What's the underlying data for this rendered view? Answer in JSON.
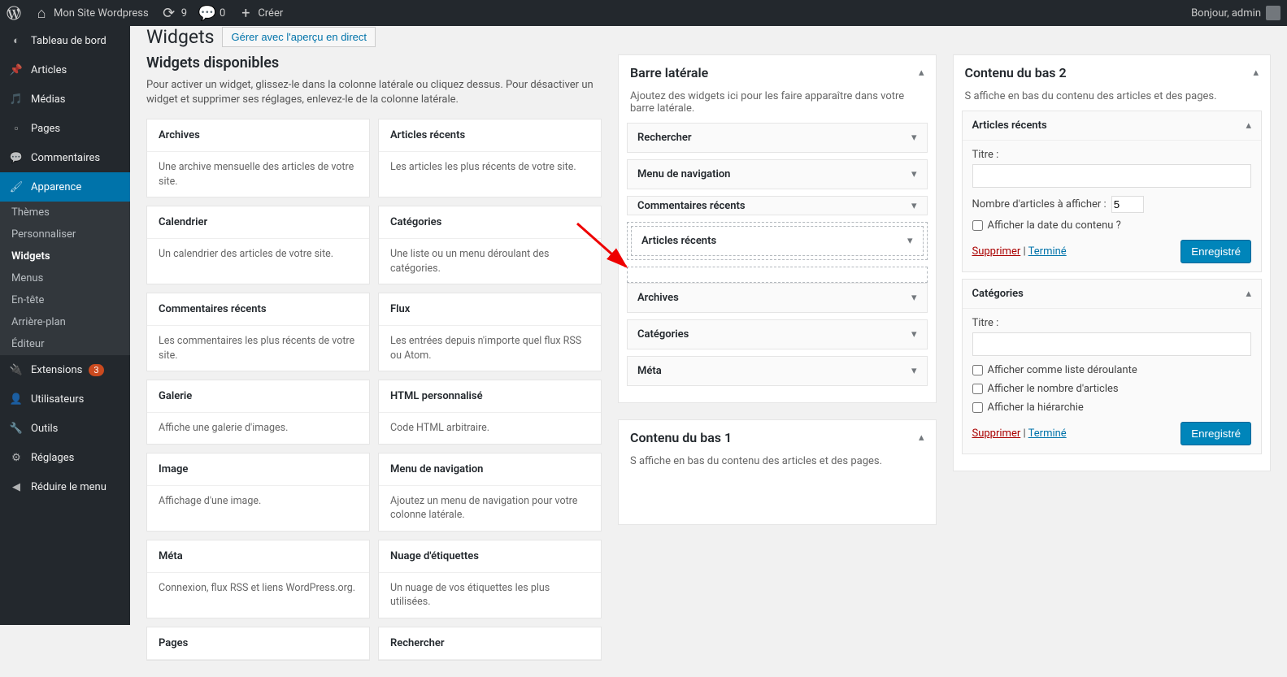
{
  "toolbar": {
    "site_name": "Mon Site Wordpress",
    "updates_count": "9",
    "comments_count": "0",
    "create_label": "Créer",
    "greeting": "Bonjour, admin"
  },
  "menu": {
    "dashboard": "Tableau de bord",
    "posts": "Articles",
    "media": "Médias",
    "pages": "Pages",
    "comments": "Commentaires",
    "appearance": "Apparence",
    "appearance_sub": {
      "themes": "Thèmes",
      "customize": "Personnaliser",
      "widgets": "Widgets",
      "menus": "Menus",
      "header": "En-tête",
      "background": "Arrière-plan",
      "editor": "Éditeur"
    },
    "plugins": "Extensions",
    "plugins_badge": "3",
    "users": "Utilisateurs",
    "tools": "Outils",
    "settings": "Réglages",
    "collapse": "Réduire le menu"
  },
  "page": {
    "title": "Widgets",
    "manage_live": "Gérer avec l'aperçu en direct"
  },
  "available": {
    "title": "Widgets disponibles",
    "desc": "Pour activer un widget, glissez-le dans la colonne latérale ou cliquez dessus. Pour désactiver un widget et supprimer ses réglages, enlevez-le de la colonne latérale.",
    "widgets": [
      {
        "name": "Archives",
        "desc": "Une archive mensuelle des articles de votre site."
      },
      {
        "name": "Articles récents",
        "desc": "Les articles les plus récents de votre site."
      },
      {
        "name": "Calendrier",
        "desc": "Un calendrier des articles de votre site."
      },
      {
        "name": "Catégories",
        "desc": "Une liste ou un menu déroulant des catégories."
      },
      {
        "name": "Commentaires récents",
        "desc": "Les commentaires les plus récents de votre site."
      },
      {
        "name": "Flux",
        "desc": "Les entrées depuis n'importe quel flux RSS ou Atom."
      },
      {
        "name": "Galerie",
        "desc": "Affiche une galerie d'images."
      },
      {
        "name": "HTML personnalisé",
        "desc": "Code HTML arbitraire."
      },
      {
        "name": "Image",
        "desc": "Affichage d'une image."
      },
      {
        "name": "Menu de navigation",
        "desc": "Ajoutez un menu de navigation pour votre colonne latérale."
      },
      {
        "name": "Méta",
        "desc": "Connexion, flux RSS et liens WordPress.org."
      },
      {
        "name": "Nuage d'étiquettes",
        "desc": "Un nuage de vos étiquettes les plus utilisées."
      },
      {
        "name": "Pages",
        "desc": ""
      },
      {
        "name": "Rechercher",
        "desc": ""
      }
    ]
  },
  "sidebar_area": {
    "title": "Barre latérale",
    "desc": "Ajoutez des widgets ici pour les faire apparaître dans votre barre latérale.",
    "widgets": [
      "Rechercher",
      "Menu de navigation",
      "Commentaires récents",
      "Archives",
      "Catégories",
      "Méta"
    ],
    "dragging": "Articles récents"
  },
  "bottom1": {
    "title": "Contenu du bas 1",
    "desc": "S affiche en bas du contenu des articles et des pages."
  },
  "bottom2": {
    "title": "Contenu du bas 2",
    "desc": "S affiche en bas du contenu des articles et des pages.",
    "recent_posts": {
      "title": "Articles récents",
      "title_label": "Titre :",
      "count_label": "Nombre d'articles à afficher :",
      "count_value": "5",
      "show_date_label": "Afficher la date du contenu ?",
      "delete": "Supprimer",
      "done": "Terminé",
      "save": "Enregistré"
    },
    "categories": {
      "title": "Catégories",
      "title_label": "Titre :",
      "dropdown_label": "Afficher comme liste déroulante",
      "count_label": "Afficher le nombre d'articles",
      "hierarchy_label": "Afficher la hiérarchie",
      "delete": "Supprimer",
      "done": "Terminé",
      "save": "Enregistré"
    }
  }
}
